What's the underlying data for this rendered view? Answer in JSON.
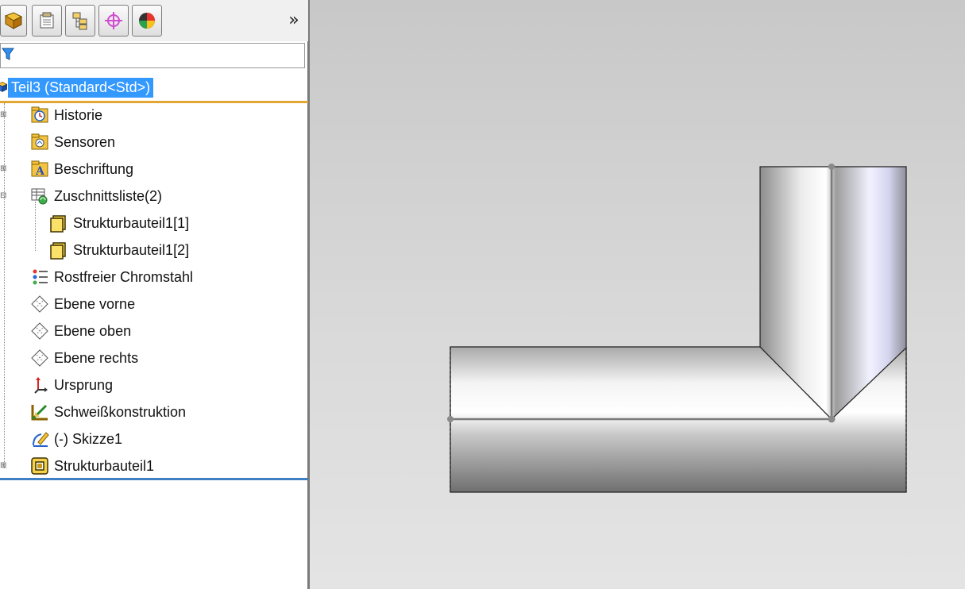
{
  "toolbar": {
    "tabs": [
      {
        "name": "featuremanager-tab",
        "icon": "featuremanager-icon"
      },
      {
        "name": "propertymanager-tab",
        "icon": "propertymanager-icon"
      },
      {
        "name": "configurationmanager-tab",
        "icon": "configurationmanager-icon"
      },
      {
        "name": "dimxpert-tab",
        "icon": "dimxpert-icon"
      },
      {
        "name": "displaymanager-tab",
        "icon": "displaymanager-icon"
      }
    ],
    "expand_label": "»"
  },
  "filter": {
    "icon": "filter-icon",
    "value": ""
  },
  "tree": {
    "root": {
      "label": "Teil3  (Standard<Std>)",
      "icon": "part-icon",
      "selected": true
    },
    "items": [
      {
        "label": "Historie",
        "icon": "history-icon"
      },
      {
        "label": "Sensoren",
        "icon": "sensor-icon"
      },
      {
        "label": "Beschriftung",
        "icon": "annotation-icon"
      },
      {
        "label": "Zuschnittsliste(2)",
        "icon": "cutlist-icon"
      },
      {
        "label": "Strukturbauteil1[1]",
        "icon": "body-icon"
      },
      {
        "label": "Strukturbauteil1[2]",
        "icon": "body-icon"
      },
      {
        "label": "Rostfreier Chromstahl",
        "icon": "material-icon"
      },
      {
        "label": "Ebene vorne",
        "icon": "plane-icon"
      },
      {
        "label": "Ebene oben",
        "icon": "plane-icon"
      },
      {
        "label": "Ebene rechts",
        "icon": "plane-icon"
      },
      {
        "label": "Ursprung",
        "icon": "origin-icon"
      },
      {
        "label": "Schweißkonstruktion",
        "icon": "weldment-icon"
      },
      {
        "label": "(-) Skizze1",
        "icon": "sketch-icon"
      },
      {
        "label": "Strukturbauteil1",
        "icon": "structural-member-icon"
      }
    ]
  },
  "colors": {
    "selection": "#3399ff",
    "root_underline": "#e2a634",
    "end_underline": "#3f7fc4"
  }
}
